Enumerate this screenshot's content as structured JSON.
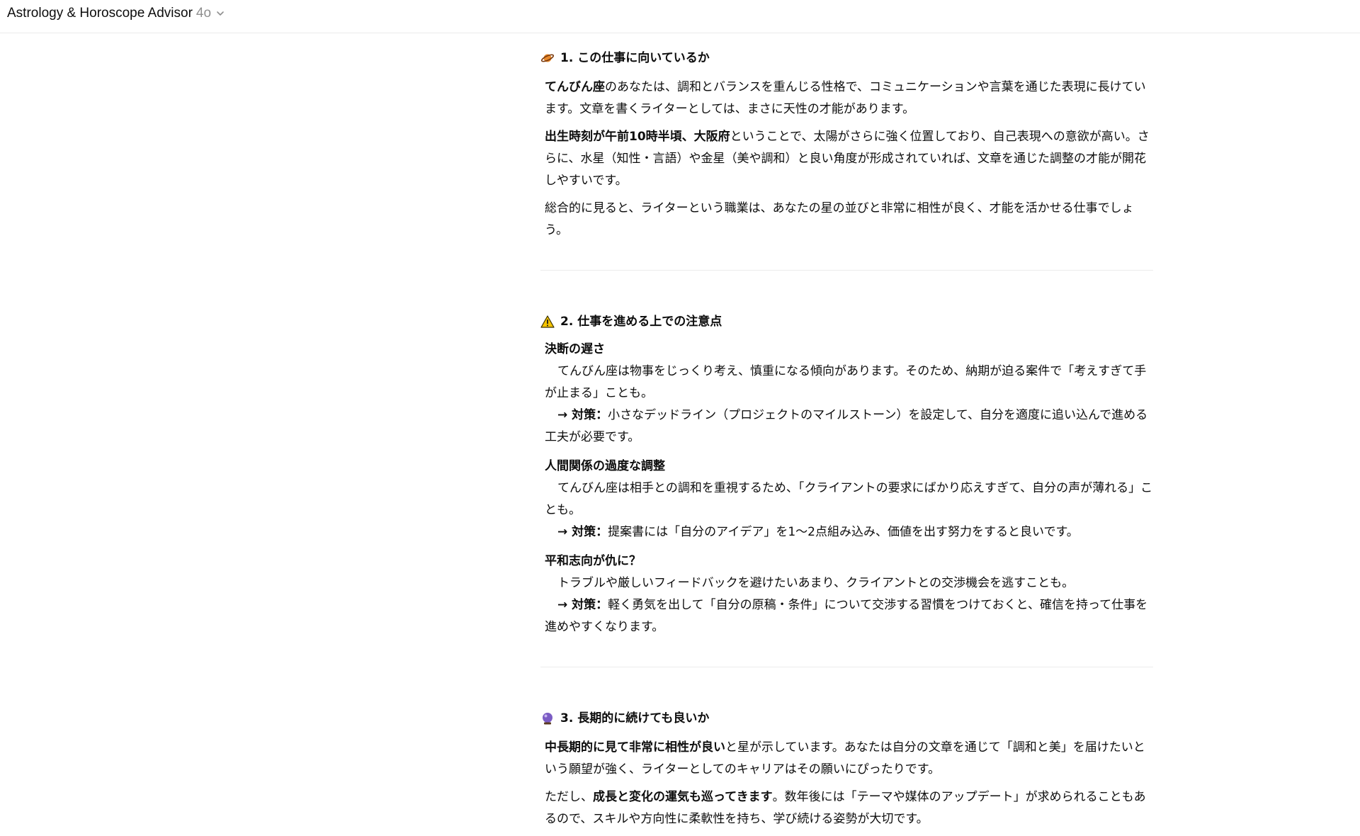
{
  "header": {
    "title": "Astrology & Horoscope Advisor",
    "model": "4o"
  },
  "sections": [
    {
      "heading": "1. この仕事に向いているか",
      "icon": "ringed-planet",
      "p1_b": "てんびん座",
      "p1_t": "のあなたは、調和とバランスを重んじる性格で、コミュニケーションや言葉を通じた表現に長けています。文章を書くライターとしては、まさに天性の才能があります。",
      "p2_b": "出生時刻が午前10時半頃、大阪府",
      "p2_t": "ということで、太陽がさらに強く位置しており、自己表現への意欲が高い。さらに、水星（知性・言語）や金星（美や調和）と良い角度が形成されていれば、文章を通じた調整の才能が開花しやすいです。",
      "p3": "総合的に見ると、ライターという職業は、あなたの星の並びと非常に相性が良く、才能を活かせる仕事でしょう。"
    },
    {
      "heading": "2. 仕事を進める上での注意点",
      "icon": "warning",
      "items": [
        {
          "title": "決断の遅さ",
          "desc": "てんびん座は物事をじっくり考え、慎重になる傾向があります。そのため、納期が迫る案件で「考えすぎて手が止まる」ことも。",
          "advice_label": "→ 対策：",
          "advice": "小さなデッドライン（プロジェクトのマイルストーン）を設定して、自分を適度に追い込んで進める工夫が必要です。"
        },
        {
          "title": "人間関係の過度な調整",
          "desc": "てんびん座は相手との調和を重視するため、「クライアントの要求にばかり応えすぎて、自分の声が薄れる」ことも。",
          "advice_label": "→ 対策：",
          "advice": "提案書には「自分のアイデア」を1〜2点組み込み、価値を出す努力をすると良いです。"
        },
        {
          "title": "平和志向が仇に？",
          "desc": "トラブルや厳しいフィードバックを避けたいあまり、クライアントとの交渉機会を逃すことも。",
          "advice_label": "→ 対策：",
          "advice": "軽く勇気を出して「自分の原稿・条件」について交渉する習慣をつけておくと、確信を持って仕事を進めやすくなります。"
        }
      ]
    },
    {
      "heading": "3. 長期的に続けても良いか",
      "icon": "crystal-ball",
      "p1_b": "中長期的に見て非常に相性が良い",
      "p1_t": "と星が示しています。あなたは自分の文章を通じて「調和と美」を届けたいという願望が強く、ライターとしてのキャリアはその願いにぴったりです。",
      "p2_pre": "ただし、",
      "p2_b": "成長と変化の運気も巡ってきます",
      "p2_t": "。数年後には「テーマや媒体のアップデート」が求められることもあるので、スキルや方向性に柔軟性を持ち、学び続ける姿勢が大切です。"
    }
  ],
  "colors": {
    "accent_planet": "#e8892b",
    "warning": "#f5c400",
    "crystal": "#7b5cc4"
  }
}
